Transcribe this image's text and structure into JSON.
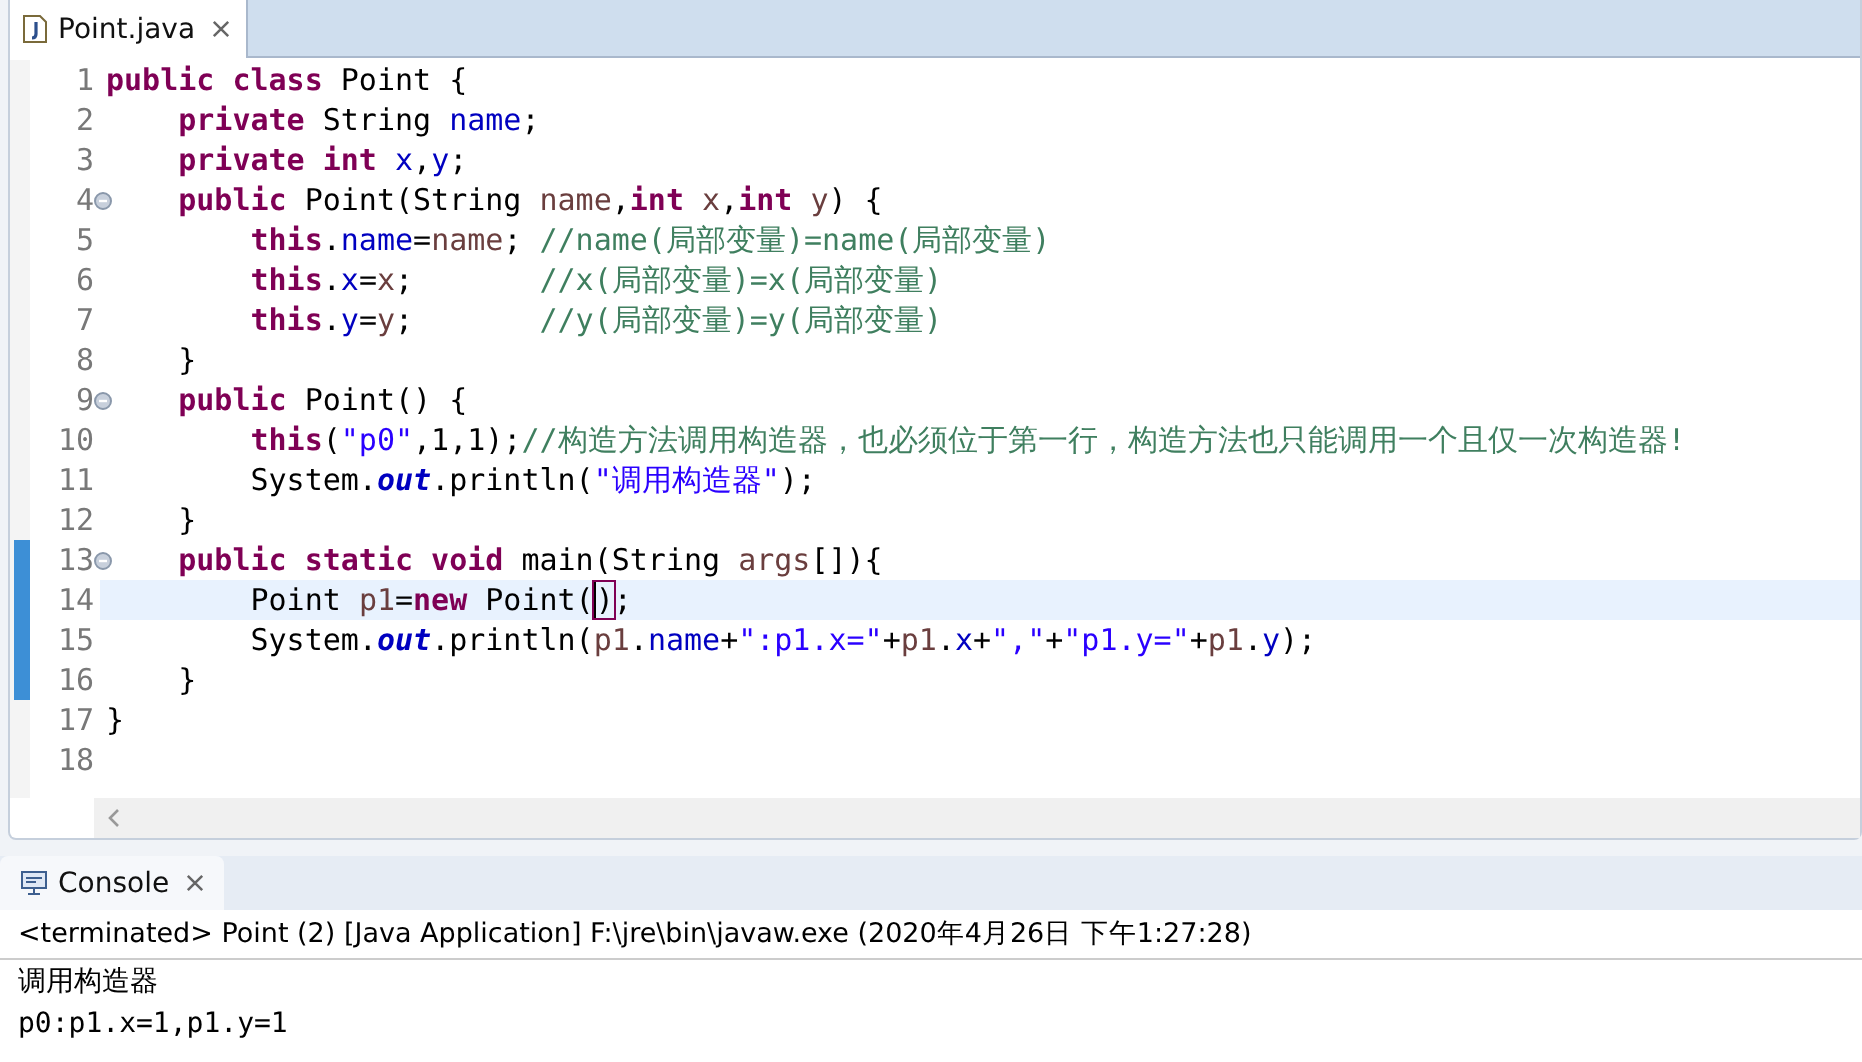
{
  "editor_tab": {
    "title": "Point.java"
  },
  "lines": [
    {
      "number": "1",
      "fold": false,
      "changed": false,
      "current": false,
      "tokens": [
        {
          "kind": "kw",
          "text": "public"
        },
        {
          "kind": "kw",
          "text": " class"
        },
        {
          "kind": "plain",
          "text": " Point {"
        }
      ]
    },
    {
      "number": "2",
      "fold": false,
      "changed": false,
      "current": false,
      "tokens": [
        {
          "kind": "kw",
          "text": "    private"
        },
        {
          "kind": "plain",
          "text": " String "
        },
        {
          "kind": "field",
          "text": "name"
        },
        {
          "kind": "plain",
          "text": ";"
        }
      ]
    },
    {
      "number": "3",
      "fold": false,
      "changed": false,
      "current": false,
      "tokens": [
        {
          "kind": "kw",
          "text": "    private"
        },
        {
          "kind": "kw",
          "text": " int"
        },
        {
          "kind": "field",
          "text": " x"
        },
        {
          "kind": "plain",
          "text": ","
        },
        {
          "kind": "field",
          "text": "y"
        },
        {
          "kind": "plain",
          "text": ";"
        }
      ]
    },
    {
      "number": "4",
      "fold": true,
      "changed": false,
      "current": false,
      "tokens": [
        {
          "kind": "kw",
          "text": "    public"
        },
        {
          "kind": "plain",
          "text": " Point(String "
        },
        {
          "kind": "local",
          "text": "name"
        },
        {
          "kind": "plain",
          "text": ","
        },
        {
          "kind": "kw",
          "text": "int"
        },
        {
          "kind": "local",
          "text": " x"
        },
        {
          "kind": "plain",
          "text": ","
        },
        {
          "kind": "kw",
          "text": "int"
        },
        {
          "kind": "local",
          "text": " y"
        },
        {
          "kind": "plain",
          "text": ") {"
        }
      ]
    },
    {
      "number": "5",
      "fold": false,
      "changed": false,
      "current": false,
      "tokens": [
        {
          "kind": "kw",
          "text": "        this"
        },
        {
          "kind": "plain",
          "text": "."
        },
        {
          "kind": "field",
          "text": "name"
        },
        {
          "kind": "plain",
          "text": "="
        },
        {
          "kind": "local",
          "text": "name"
        },
        {
          "kind": "plain",
          "text": "; "
        },
        {
          "kind": "comment",
          "text": "//name(局部变量)=name(局部变量)"
        }
      ]
    },
    {
      "number": "6",
      "fold": false,
      "changed": false,
      "current": false,
      "tokens": [
        {
          "kind": "kw",
          "text": "        this"
        },
        {
          "kind": "plain",
          "text": "."
        },
        {
          "kind": "field",
          "text": "x"
        },
        {
          "kind": "plain",
          "text": "="
        },
        {
          "kind": "local",
          "text": "x"
        },
        {
          "kind": "plain",
          "text": ";       "
        },
        {
          "kind": "comment",
          "text": "//x(局部变量)=x(局部变量)"
        }
      ]
    },
    {
      "number": "7",
      "fold": false,
      "changed": false,
      "current": false,
      "tokens": [
        {
          "kind": "kw",
          "text": "        this"
        },
        {
          "kind": "plain",
          "text": "."
        },
        {
          "kind": "field",
          "text": "y"
        },
        {
          "kind": "plain",
          "text": "="
        },
        {
          "kind": "local",
          "text": "y"
        },
        {
          "kind": "plain",
          "text": ";       "
        },
        {
          "kind": "comment",
          "text": "//y(局部变量)=y(局部变量)"
        }
      ]
    },
    {
      "number": "8",
      "fold": false,
      "changed": false,
      "current": false,
      "tokens": [
        {
          "kind": "plain",
          "text": "    }"
        }
      ]
    },
    {
      "number": "9",
      "fold": true,
      "changed": false,
      "current": false,
      "tokens": [
        {
          "kind": "kw",
          "text": "    public"
        },
        {
          "kind": "plain",
          "text": " Point() {"
        }
      ]
    },
    {
      "number": "10",
      "fold": false,
      "changed": false,
      "current": false,
      "tokens": [
        {
          "kind": "kw",
          "text": "        this"
        },
        {
          "kind": "plain",
          "text": "("
        },
        {
          "kind": "string",
          "text": "\"p0\""
        },
        {
          "kind": "plain",
          "text": ",1,1);"
        },
        {
          "kind": "comment",
          "text": "//构造方法调用构造器，也必须位于第一行，构造方法也只能调用一个且仅一次构造器!"
        }
      ]
    },
    {
      "number": "11",
      "fold": false,
      "changed": false,
      "current": false,
      "tokens": [
        {
          "kind": "plain",
          "text": "        System."
        },
        {
          "kind": "static",
          "text": "out"
        },
        {
          "kind": "plain",
          "text": ".println("
        },
        {
          "kind": "string",
          "text": "\"调用构造器\""
        },
        {
          "kind": "plain",
          "text": ");"
        }
      ]
    },
    {
      "number": "12",
      "fold": false,
      "changed": false,
      "current": false,
      "tokens": [
        {
          "kind": "plain",
          "text": "    }"
        }
      ]
    },
    {
      "number": "13",
      "fold": true,
      "changed": true,
      "current": false,
      "tokens": [
        {
          "kind": "kw",
          "text": "    public"
        },
        {
          "kind": "kw",
          "text": " static"
        },
        {
          "kind": "kw",
          "text": " void"
        },
        {
          "kind": "plain",
          "text": " main(String "
        },
        {
          "kind": "local",
          "text": "args"
        },
        {
          "kind": "plain",
          "text": "[]){"
        }
      ]
    },
    {
      "number": "14",
      "fold": false,
      "changed": true,
      "current": true,
      "tokens": [
        {
          "kind": "plain",
          "text": "        Point "
        },
        {
          "kind": "local",
          "text": "p1"
        },
        {
          "kind": "plain",
          "text": "="
        },
        {
          "kind": "kw",
          "text": "new"
        },
        {
          "kind": "plain",
          "text": " Point("
        },
        {
          "kind": "match",
          "text": ")"
        },
        {
          "kind": "plain",
          "text": ";"
        }
      ]
    },
    {
      "number": "15",
      "fold": false,
      "changed": true,
      "current": false,
      "tokens": [
        {
          "kind": "plain",
          "text": "        System."
        },
        {
          "kind": "static",
          "text": "out"
        },
        {
          "kind": "plain",
          "text": ".println("
        },
        {
          "kind": "local",
          "text": "p1"
        },
        {
          "kind": "plain",
          "text": "."
        },
        {
          "kind": "field",
          "text": "name"
        },
        {
          "kind": "plain",
          "text": "+"
        },
        {
          "kind": "string",
          "text": "\":p1.x=\""
        },
        {
          "kind": "plain",
          "text": "+"
        },
        {
          "kind": "local",
          "text": "p1"
        },
        {
          "kind": "plain",
          "text": "."
        },
        {
          "kind": "field",
          "text": "x"
        },
        {
          "kind": "plain",
          "text": "+"
        },
        {
          "kind": "string",
          "text": "\",\""
        },
        {
          "kind": "plain",
          "text": "+"
        },
        {
          "kind": "string",
          "text": "\"p1.y=\""
        },
        {
          "kind": "plain",
          "text": "+"
        },
        {
          "kind": "local",
          "text": "p1"
        },
        {
          "kind": "plain",
          "text": "."
        },
        {
          "kind": "field",
          "text": "y"
        },
        {
          "kind": "plain",
          "text": ");"
        }
      ]
    },
    {
      "number": "16",
      "fold": false,
      "changed": true,
      "current": false,
      "tokens": [
        {
          "kind": "plain",
          "text": "    }"
        }
      ]
    },
    {
      "number": "17",
      "fold": false,
      "changed": false,
      "current": false,
      "tokens": [
        {
          "kind": "plain",
          "text": "}"
        }
      ]
    },
    {
      "number": "18",
      "fold": false,
      "changed": false,
      "current": false
    }
  ],
  "console": {
    "tab": "Console",
    "header": "<terminated> Point (2) [Java Application] F:\\jre\\bin\\javaw.exe (2020年4月26日 下午1:27:28)",
    "output": [
      "调用构造器",
      "p0:p1.x=1,p1.y=1"
    ]
  }
}
